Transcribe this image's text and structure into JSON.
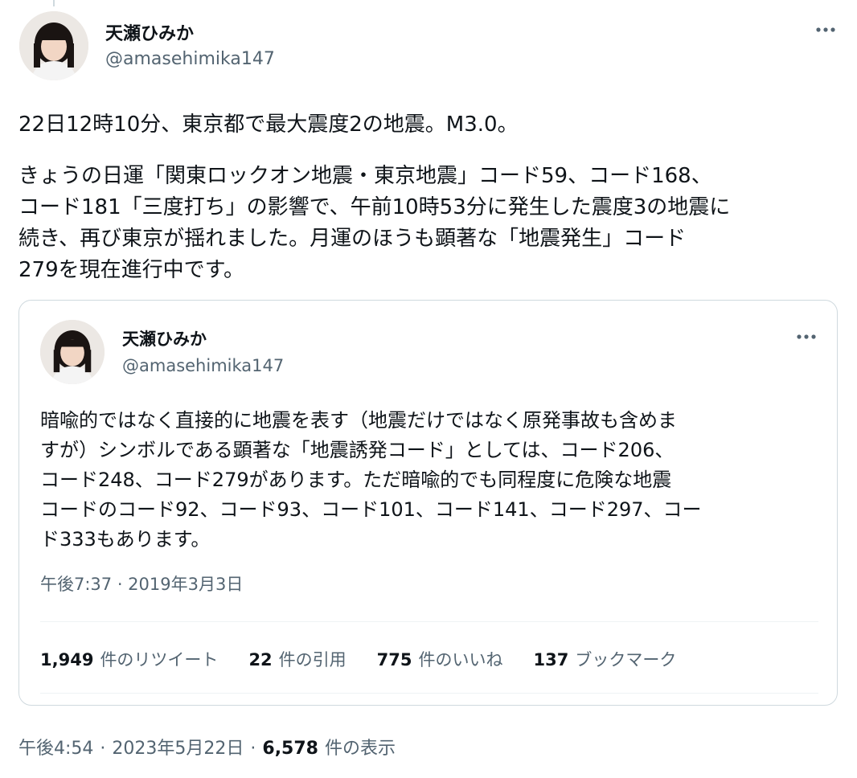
{
  "tweet": {
    "author": {
      "name": "天瀬ひみか",
      "handle": "@amasehimika147",
      "avatar_icon": "avatar-photo"
    },
    "more_icon": "more-options-icon",
    "body_lines": [
      "22日12時10分、東京都で最大震度2の地震。M3.0。",
      "",
      "きょうの日運「関東ロックオン地震・東京地震」コード59、コード168、",
      "コード181「三度打ち」の影響で、午前10時53分に発生した震度3の地震に",
      "続き、再び東京が揺れました。月運のほうも顕著な「地震発生」コード",
      "279を現在進行中です。"
    ],
    "time": "午後4:54",
    "separator": "·",
    "date": "2023年5月22日",
    "views_count": "6,578",
    "views_label": "件の表示"
  },
  "quoted": {
    "author": {
      "name": "天瀬ひみか",
      "handle": "@amasehimika147"
    },
    "body_lines": [
      "暗喩的ではなく直接的に地震を表す（地震だけではなく原発事故も含めま",
      "すが）シンボルである顕著な「地震誘発コード」としては、コード206、",
      "コード248、コード279があります。ただ暗喩的でも同程度に危険な地震",
      "コードのコード92、コード93、コード101、コード141、コード297、コー",
      "ド333もあります。"
    ],
    "timestamp": "午後7:37 · 2019年3月3日",
    "stats": [
      {
        "count": "1,949",
        "label": "件のリツイート"
      },
      {
        "count": "22",
        "label": "件の引用"
      },
      {
        "count": "775",
        "label": "件のいいね"
      },
      {
        "count": "137",
        "label": "ブックマーク"
      }
    ]
  },
  "colors": {
    "text_primary": "#0f1419",
    "text_secondary": "#536471",
    "border": "#cfd9de",
    "divider": "#eff3f4"
  }
}
